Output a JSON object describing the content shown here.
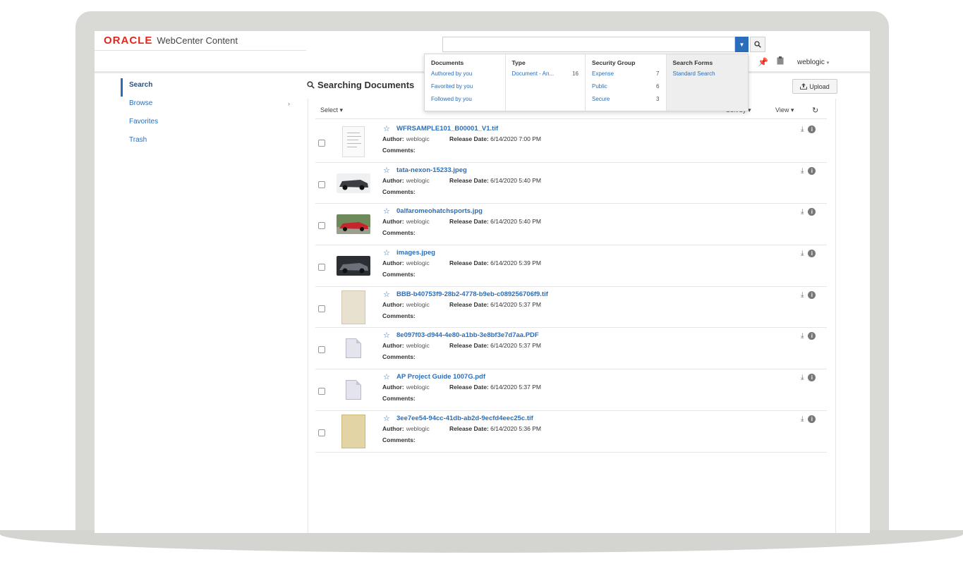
{
  "header": {
    "brand": "ORACLE",
    "product": "WebCenter Content",
    "user": "weblogic"
  },
  "search": {
    "placeholder": "",
    "dropdown_icon": "chevron-down-icon",
    "go_icon": "search-icon"
  },
  "dropdown": {
    "columns": [
      {
        "title": "Documents",
        "items": [
          {
            "label": "Authored by you",
            "count": ""
          },
          {
            "label": "Favorited by you",
            "count": ""
          },
          {
            "label": "Followed by you",
            "count": ""
          }
        ]
      },
      {
        "title": "Type",
        "items": [
          {
            "label": "Document - An...",
            "count": "16"
          }
        ]
      },
      {
        "title": "Security Group",
        "items": [
          {
            "label": "Expense",
            "count": "7"
          },
          {
            "label": "Public",
            "count": "6"
          },
          {
            "label": "Secure",
            "count": "3"
          }
        ]
      },
      {
        "title": "Search Forms",
        "items": [
          {
            "label": "Standard Search",
            "count": ""
          }
        ]
      }
    ]
  },
  "nav": {
    "items": [
      {
        "label": "Search",
        "active": true
      },
      {
        "label": "Browse",
        "active": false
      },
      {
        "label": "Favorites",
        "active": false
      },
      {
        "label": "Trash",
        "active": false
      }
    ]
  },
  "main": {
    "title": "Searching Documents",
    "upload_label": "Upload",
    "select_label": "Select",
    "sort_label": "Sort by",
    "view_label": "View"
  },
  "labels": {
    "author": "Author:",
    "release": "Release Date:",
    "comments": "Comments:"
  },
  "documents": [
    {
      "name": "WFRSAMPLE101_B00001_V1.tif",
      "author": "weblogic",
      "date": "6/14/2020 7:00 PM",
      "thumb": "document"
    },
    {
      "name": "tata-nexon-15233.jpeg",
      "author": "weblogic",
      "date": "6/14/2020 5:40 PM",
      "thumb": "car-dark"
    },
    {
      "name": "0alfaromeohatchsports.jpg",
      "author": "weblogic",
      "date": "6/14/2020 5:40 PM",
      "thumb": "car-red"
    },
    {
      "name": "images.jpeg",
      "author": "weblogic",
      "date": "6/14/2020 5:39 PM",
      "thumb": "car-gray"
    },
    {
      "name": "BBB-b40753f9-28b2-4778-b9eb-c089256706f9.tif",
      "author": "weblogic",
      "date": "6/14/2020 5:37 PM",
      "thumb": "scan"
    },
    {
      "name": "8e097f03-d944-4e80-a1bb-3e8bf3e7d7aa.PDF",
      "author": "weblogic",
      "date": "6/14/2020 5:37 PM",
      "thumb": "file"
    },
    {
      "name": "AP Project Guide 1007G.pdf",
      "author": "weblogic",
      "date": "6/14/2020 5:37 PM",
      "thumb": "file"
    },
    {
      "name": "3ee7ee54-94cc-41db-ab2d-9ecfd4eec25c.tif",
      "author": "weblogic",
      "date": "6/14/2020 5:36 PM",
      "thumb": "scan-yellow"
    }
  ],
  "colors": {
    "brand_red": "#e3261c",
    "link_blue": "#2a6ebb",
    "car_dark": "#3a3d42",
    "car_red": "#c8242b",
    "car_gray": "#6c7078"
  }
}
